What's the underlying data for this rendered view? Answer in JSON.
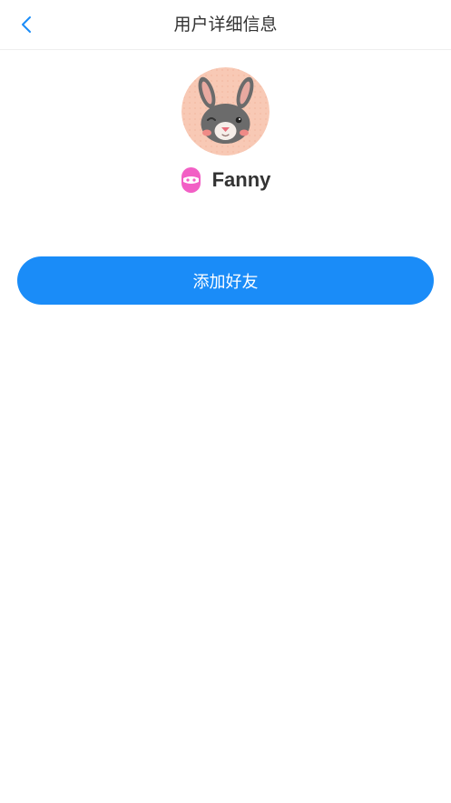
{
  "header": {
    "title": "用户详细信息",
    "back_icon": "chevron-left-icon"
  },
  "profile": {
    "avatar_icon": "rabbit-avatar",
    "gender_icon": "female-badge-icon",
    "username": "Fanny"
  },
  "actions": {
    "add_friend_label": "添加好友"
  },
  "colors": {
    "accent": "#1a8cf8",
    "avatar_bg": "#f8c9b5",
    "gender_badge": "#f25fc5"
  }
}
